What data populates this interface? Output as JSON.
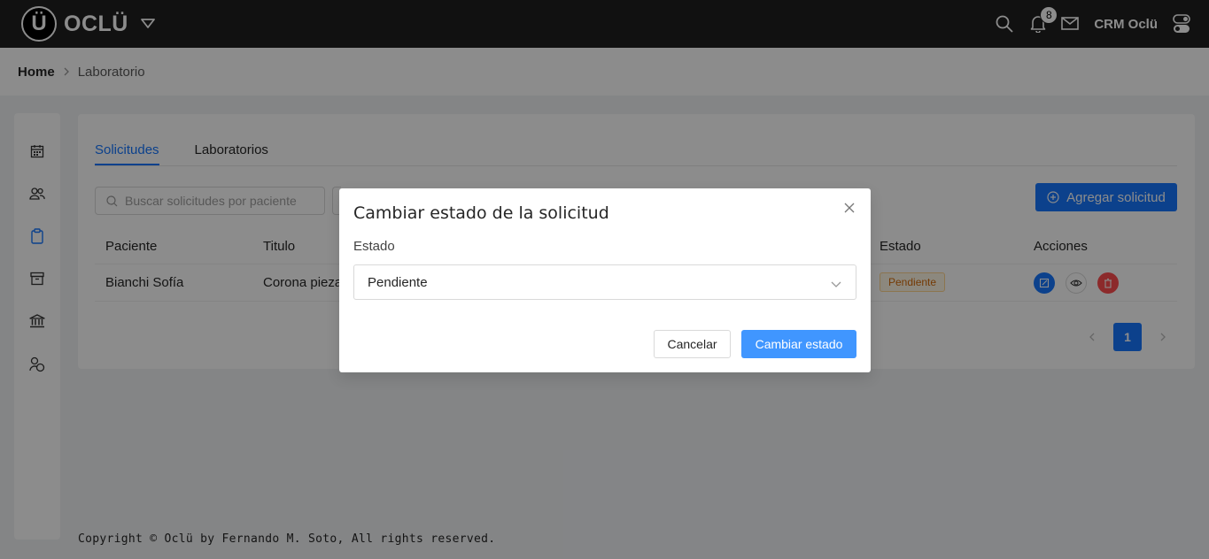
{
  "header": {
    "logo_letter": "Ü",
    "brand": "OCLÜ",
    "notifications_count": "8",
    "crm_name": "CRM Oclü"
  },
  "breadcrumb": {
    "home": "Home",
    "current": "Laboratorio"
  },
  "sidebar": {
    "icons": [
      "calendar-icon",
      "users-icon",
      "clipboard-icon",
      "archive-icon",
      "bank-icon",
      "user-group-icon"
    ]
  },
  "main": {
    "tabs": [
      {
        "label": "Solicitudes",
        "active": true
      },
      {
        "label": "Laboratorios",
        "active": false
      }
    ],
    "search_placeholder": "Buscar solicitudes por paciente",
    "add_button": "Agregar solicitud",
    "columns": [
      "Paciente",
      "Titulo",
      "Estado",
      "Acciones"
    ],
    "rows": [
      {
        "paciente": "Bianchi Sofía",
        "titulo": "Corona pieza",
        "estado": "Pendiente"
      }
    ],
    "pagination": {
      "current": "1"
    }
  },
  "footer": {
    "copyright": "Copyright © Oclü by Fernando M. Soto, All rights reserved."
  },
  "modal": {
    "title": "Cambiar estado de la solicitud",
    "field_label": "Estado",
    "selected_value": "Pendiente",
    "cancel_label": "Cancelar",
    "ok_label": "Cambiar estado"
  },
  "colors": {
    "topbar": "#1f1f1f",
    "primary": "#1677ff",
    "danger": "#ff4d4f",
    "warning_tag": "#d46b08"
  }
}
